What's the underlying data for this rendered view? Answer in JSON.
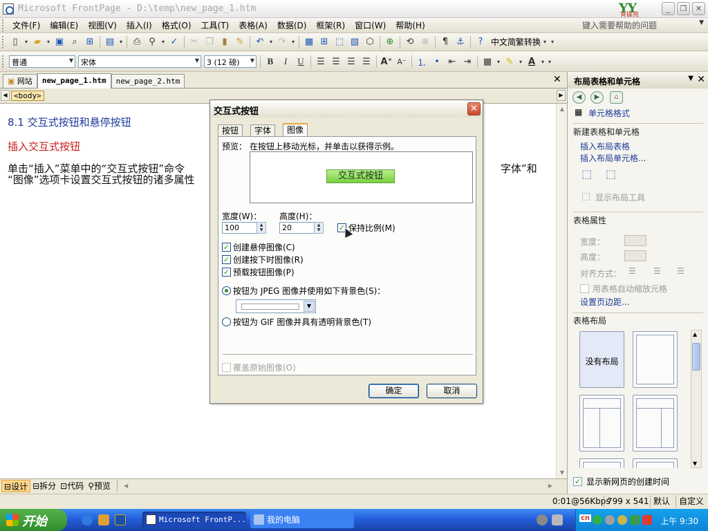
{
  "window": {
    "title": "Microsoft FrontPage - D:\\temp\\new_page_1.htm",
    "logo_text": "YY",
    "logo_sub": "育碟苑"
  },
  "menu": {
    "items": [
      "文件(F)",
      "编辑(E)",
      "视图(V)",
      "插入(I)",
      "格式(O)",
      "工具(T)",
      "表格(A)",
      "数据(D)",
      "框架(R)",
      "窗口(W)",
      "帮助(H)"
    ],
    "help_placeholder": "键入需要帮助的问题"
  },
  "toolbar": {
    "convert_label": "中文简繁转换"
  },
  "format_bar": {
    "style_value": "普通",
    "font_value": "宋体",
    "size_value": "3 (12 磅)",
    "bold": "B",
    "italic": "I",
    "underline": "U"
  },
  "doc_tabs": {
    "site": "网站",
    "tab1": "new_page_1.htm",
    "tab2": "new_page_2.htm"
  },
  "quicktag": "<body>",
  "document": {
    "heading1": "8.1 交互式按钮和悬停按钮",
    "heading2": "插入交互式按钮",
    "para_start": "单击“插入”菜单中的“交互式按钮”命令",
    "para_end": "字体”和",
    "para_line2": "“图像”选项卡设置交互式按钮的诸多属性"
  },
  "view_bar": {
    "design": "设计",
    "split": "拆分",
    "code": "代码",
    "preview": "预览"
  },
  "status": {
    "speed": "0:01@56Kbps",
    "size": "799 x 541",
    "default": "默认",
    "custom": "自定义"
  },
  "task_pane": {
    "title": "布局表格和单元格",
    "cell_format": "单元格格式",
    "new_section": "新建表格和单元格",
    "insert_table": "插入布局表格",
    "insert_cell": "插入布局单元格...",
    "show_tools": "显示布局工具",
    "props_section": "表格属性",
    "width": "宽度：",
    "height": "高度：",
    "align": "对齐方式：",
    "autoscale": "用表格自动缩放元格",
    "margins": "设置页边距...",
    "layout_section": "表格布局",
    "no_layout": "没有布局",
    "show_time": "显示新网页的创建时间"
  },
  "dialog": {
    "title": "交互式按钮",
    "tabs": [
      "按钮",
      "字体",
      "图像"
    ],
    "preview_label": "预览：",
    "preview_hint": "在按钮上移动光标，并单击以获得示例。",
    "preview_button": "交互式按钮",
    "width_label": "宽度(W)：",
    "width_value": "100",
    "height_label": "高度(H)：",
    "height_value": "20",
    "keep_ratio": "保持比例(M)",
    "create_hover": "创建悬停图像(C)",
    "create_press": "创建按下时图像(R)",
    "preload": "预载按钮图像(P)",
    "jpeg_option": "按钮为 JPEG 图像并使用如下背景色(S)：",
    "gif_option": "按钮为 GIF 图像并具有透明背景色(T)",
    "overwrite": "覆盖原始图像(O)",
    "ok": "确定",
    "cancel": "取消"
  },
  "taskbar": {
    "start": "开始",
    "item1": "Microsoft FrontP...",
    "item2": "我的电脑",
    "ime": "cn",
    "clock": "上午 9:30"
  },
  "colors": {
    "accent": "#245edb",
    "link": "#1c3a9c",
    "heading_red": "#c81e1e",
    "preview_button": "#79d040"
  }
}
